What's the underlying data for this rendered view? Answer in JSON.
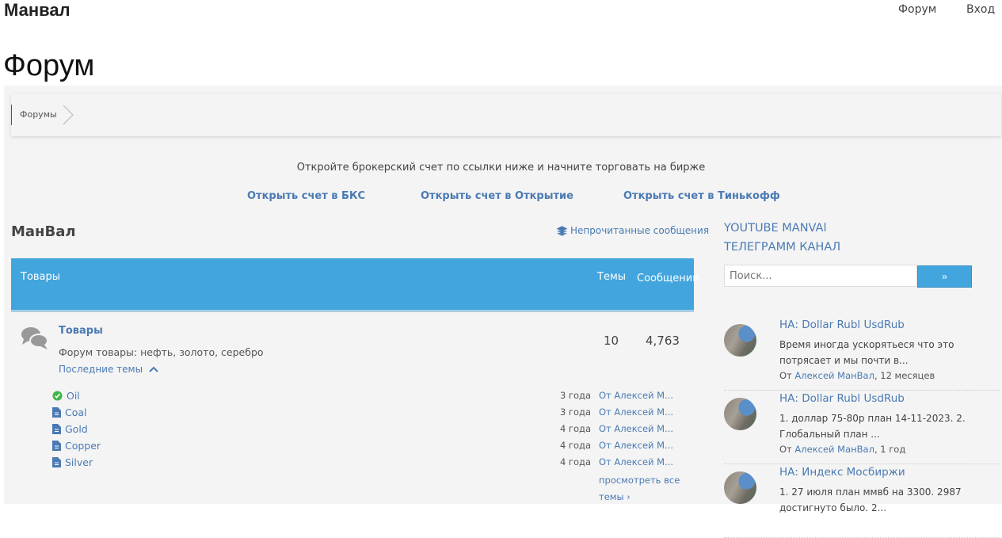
{
  "header": {
    "brand": "Манвал",
    "nav": [
      "Форум",
      "Вход"
    ]
  },
  "page_title": "Форум",
  "breadcrumb": [
    "Форумы"
  ],
  "promo": {
    "text": "Откройте брокерский счет  по ссылки ниже и начните торговать на бирже",
    "links": [
      "Открыть счет в БКС",
      "Открыть счет в Открытие",
      "Открыть счет в Тинькофф"
    ]
  },
  "section": {
    "title": "МанВал",
    "unread": "Непрочитанные сообщения"
  },
  "table": {
    "header": {
      "name": "Товары",
      "topics": "Темы",
      "posts": "Сообщений"
    },
    "forum": {
      "name": "Товары",
      "desc": "Форум товары: нефть, золото, серебро",
      "latest": "Последние темы",
      "topics": "10",
      "posts": "4,763"
    },
    "topic_list": [
      {
        "title": "Oil",
        "icon": "check-circle",
        "age": "3 года",
        "by": "От Алексей М..."
      },
      {
        "title": "Coal",
        "icon": "file",
        "age": "3 года",
        "by": "От Алексей М..."
      },
      {
        "title": "Gold",
        "icon": "file",
        "age": "4 года",
        "by": "От Алексей М..."
      },
      {
        "title": "Copper",
        "icon": "file",
        "age": "4 года",
        "by": "От Алексей М..."
      },
      {
        "title": "Silver",
        "icon": "file",
        "age": "4 года",
        "by": "От Алексей М..."
      }
    ],
    "view_all": "просмотреть все темы"
  },
  "sidebar": {
    "links": [
      "YOUTUBE MANVAl",
      "ТЕЛЕГРАММ КАНАЛ"
    ],
    "search_placeholder": "Поиск...",
    "search_button": "»",
    "posts": [
      {
        "title": "НА: Dollar Rubl UsdRub",
        "body": "Время иногда ускорятьеся что это потрясает и мы почти в...",
        "by_prefix": "От ",
        "author": "Алексей МанВал",
        "when": ", 12 месяцев"
      },
      {
        "title": "НА: Dollar Rubl UsdRub",
        "body": "1. доллар 75-80р план 14-11-2023. 2. Глобальный план ...",
        "by_prefix": "От ",
        "author": "Алексей МанВал",
        "when": ", 1 год"
      },
      {
        "title": "НА: Индекс Мосбиржи",
        "body": "1. 27 июля план ммвб на 3300. 2987 достигнуто было. 2..."
      }
    ]
  }
}
